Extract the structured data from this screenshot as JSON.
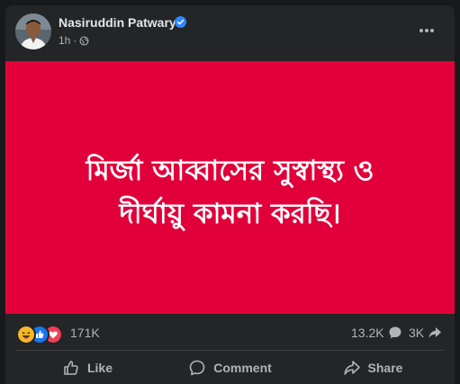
{
  "post": {
    "author": "Nasiruddin Patwary",
    "time": "1h",
    "separator": "·",
    "image_text": "মির্জা আব্বাসের সুস্বাস্থ্য ও\nদীর্ঘায়ু কামনা করছি।",
    "image_background": "#e2003b"
  },
  "reactions": {
    "types": [
      "haha",
      "like",
      "love"
    ],
    "count": "171K"
  },
  "stats": {
    "comments": "13.2K",
    "shares": "3K"
  },
  "actions": {
    "like": "Like",
    "comment": "Comment",
    "share": "Share"
  },
  "colors": {
    "card": "#242526",
    "text_primary": "#e4e6eb",
    "text_secondary": "#b0b3b8",
    "verified": "#2d88ff",
    "like": "#1877f2",
    "love": "#f33e58",
    "haha": "#f7b928"
  },
  "icons": {
    "verified": "verified-badge-icon",
    "audience": "globe-icon",
    "more": "more-horizontal-icon",
    "comment": "comment-bubble-icon",
    "share": "share-arrow-icon"
  }
}
